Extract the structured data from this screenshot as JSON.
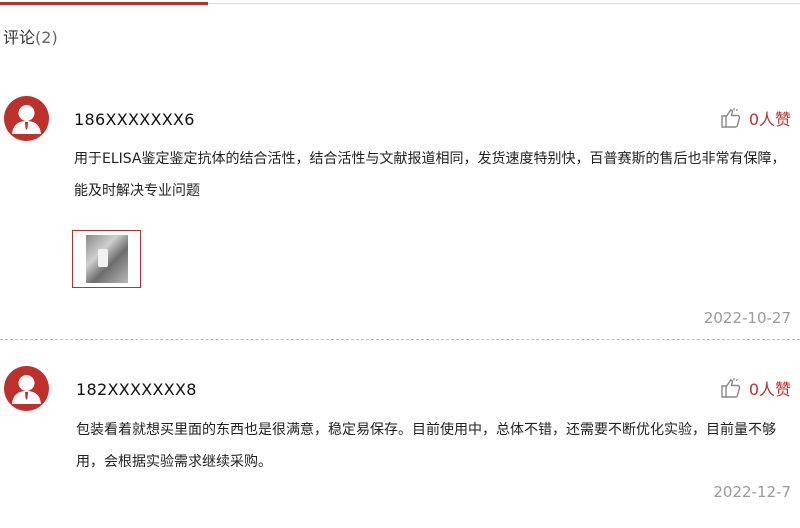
{
  "comments_section": {
    "title": "评论",
    "count": "(2)"
  },
  "reviews": [
    {
      "username": "186XXXXXXX6",
      "likes": "0人赞",
      "text": "用于ELISA鉴定鉴定抗体的结合活性，结合活性与文献报道相同，发货速度特别快，百普赛斯的售后也非常有保障，能及时解决专业问题",
      "date": "2022-10-27"
    },
    {
      "username": "182XXXXXXX8",
      "likes": "0人赞",
      "text": "包装看着就想买里面的东西也是很满意，稳定易保存。目前使用中，总体不错，还需要不断优化实验，目前量不够用，会根据实验需求继续采购。",
      "date": "2022-12-7"
    }
  ],
  "colors": {
    "accent": "#c0302b",
    "date": "#9a9a9a"
  }
}
